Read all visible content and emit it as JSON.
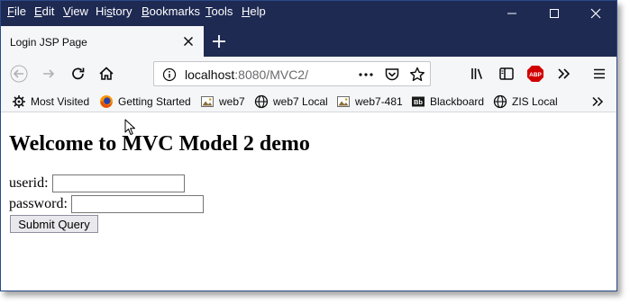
{
  "menu": {
    "items": [
      {
        "key": "F",
        "rest": "ile"
      },
      {
        "key": "E",
        "rest": "dit"
      },
      {
        "key": "V",
        "rest": "iew"
      },
      {
        "key": "",
        "pre": "Hi",
        "key2": "s",
        "rest": "tory"
      },
      {
        "key": "B",
        "rest": "ookmarks"
      },
      {
        "key": "T",
        "rest": "ools"
      },
      {
        "key": "H",
        "rest": "elp"
      }
    ]
  },
  "tab": {
    "title": "Login JSP Page"
  },
  "url": {
    "host": "localhost",
    "rest": ":8080/MVC2/"
  },
  "bookmarks": [
    {
      "label": "Most Visited",
      "icon": "gear-icon"
    },
    {
      "label": "Getting Started",
      "icon": "firefox-icon"
    },
    {
      "label": "web7",
      "icon": "image-icon"
    },
    {
      "label": "web7 Local",
      "icon": "globe-icon"
    },
    {
      "label": "web7-481",
      "icon": "image-icon"
    },
    {
      "label": "Blackboard",
      "icon": "blackboard-icon"
    },
    {
      "label": "ZIS Local",
      "icon": "globe-icon"
    }
  ],
  "page": {
    "heading": "Welcome to MVC Model 2 demo",
    "userid_label": "userid:",
    "password_label": "password:",
    "userid_value": "",
    "password_value": "",
    "submit_label": "Submit Query"
  },
  "colors": {
    "titlebar": "#1e2a52",
    "toolbar": "#f5f6f7",
    "abp": "#d10000"
  }
}
